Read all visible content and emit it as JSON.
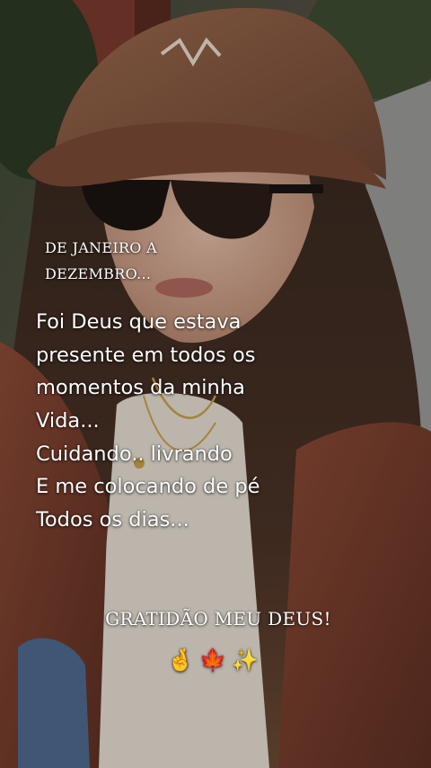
{
  "overlay": {
    "heading_lines": [
      "DE JANEIRO A",
      "DEZEMBRO..."
    ],
    "body_lines": [
      "Foi Deus que estava",
      "presente em todos os",
      "momentos da minha",
      "Vida...",
      "Cuidando.. livrando",
      "E me colocando de pé",
      "Todos os dias..."
    ],
    "closing": "GRATIDÃO MEU DEUS!",
    "emoji_line": "🤞🍁✨"
  },
  "colors": {
    "cap": "#8a5a40",
    "jacket": "#7a3f2e",
    "hair": "#2f2119",
    "text": "#ffffff"
  }
}
